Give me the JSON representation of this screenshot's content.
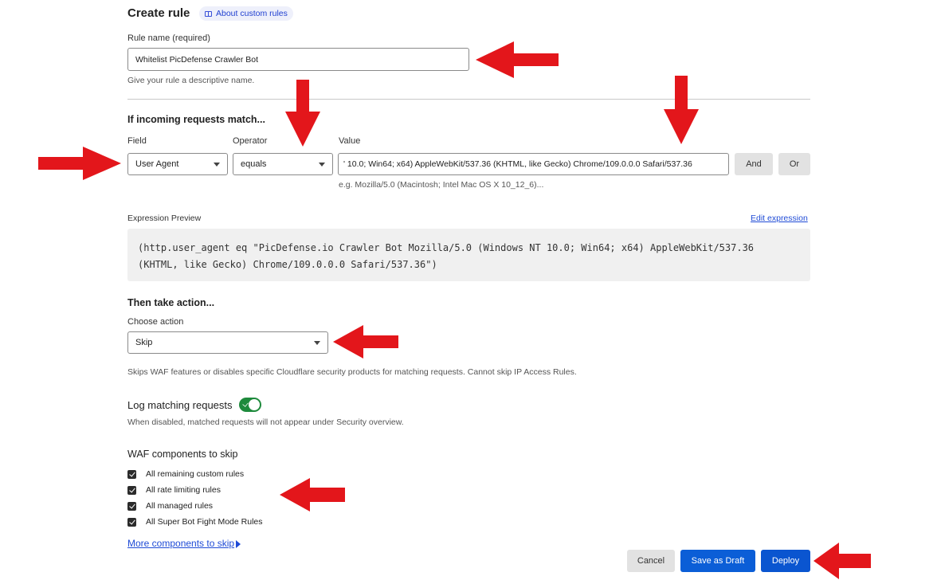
{
  "header": {
    "title": "Create rule",
    "about_link": "About custom rules"
  },
  "rule_name": {
    "label": "Rule name (required)",
    "value": "Whitelist PicDefense Crawler Bot",
    "hint": "Give your rule a descriptive name."
  },
  "match": {
    "heading": "If incoming requests match...",
    "field_label": "Field",
    "field_value": "User Agent",
    "operator_label": "Operator",
    "operator_value": "equals",
    "value_label": "Value",
    "value_text": "' 10.0; Win64; x64) AppleWebKit/537.36 (KHTML, like Gecko) Chrome/109.0.0.0 Safari/537.36",
    "value_hint": "e.g. Mozilla/5.0 (Macintosh; Intel Mac OS X 10_12_6)...",
    "and_label": "And",
    "or_label": "Or"
  },
  "expression": {
    "label": "Expression Preview",
    "edit_link": "Edit expression",
    "line1": "(http.user_agent eq \"PicDefense.io Crawler Bot Mozilla/5.0 (Windows NT 10.0; Win64; x64) AppleWebKit/537.36",
    "line2": "(KHTML, like Gecko) Chrome/109.0.0.0 Safari/537.36\")"
  },
  "action": {
    "heading": "Then take action...",
    "choose_label": "Choose action",
    "value": "Skip",
    "description": "Skips WAF features or disables specific Cloudflare security products for matching requests. Cannot skip IP Access Rules."
  },
  "log": {
    "label": "Log matching requests",
    "enabled": true,
    "description": "When disabled, matched requests will not appear under Security overview."
  },
  "waf": {
    "heading": "WAF components to skip",
    "items": [
      {
        "label": "All remaining custom rules",
        "checked": true
      },
      {
        "label": "All rate limiting rules",
        "checked": true
      },
      {
        "label": "All managed rules",
        "checked": true
      },
      {
        "label": "All Super Bot Fight Mode Rules",
        "checked": true
      }
    ],
    "more_link": "More components to skip"
  },
  "footer": {
    "cancel": "Cancel",
    "save_draft": "Save as Draft",
    "deploy": "Deploy"
  },
  "colors": {
    "primary": "#0b5ed7",
    "toggle_on": "#1e8a3c",
    "annotation_arrow": "#e3161b"
  }
}
